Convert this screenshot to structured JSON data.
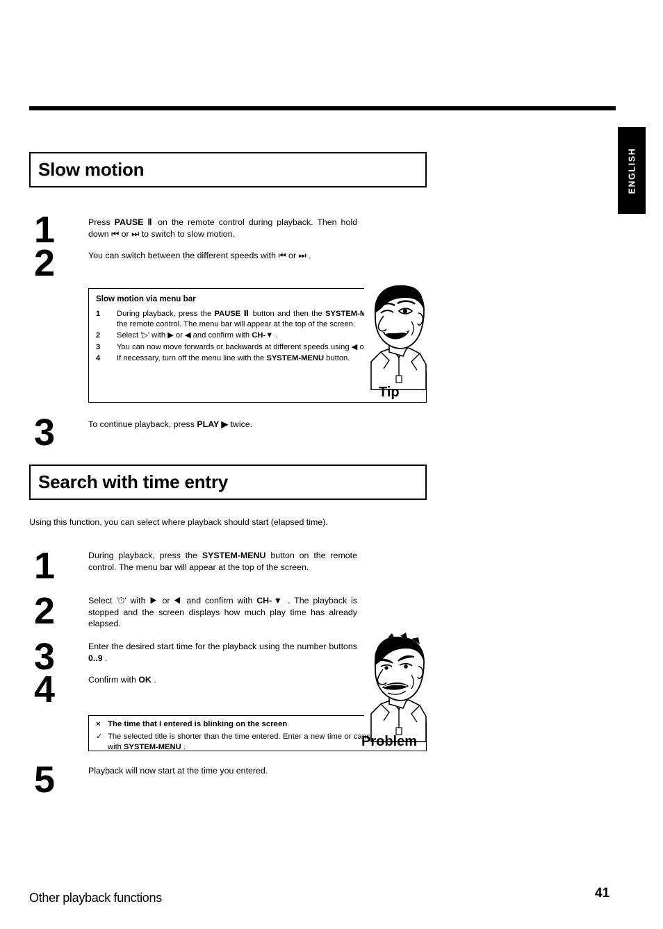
{
  "language_tab": "ENGLISH",
  "sections": [
    {
      "id": "slow-motion",
      "heading": "Slow motion",
      "steps": [
        {
          "number": "1",
          "text_html": "Press <b>PAUSE Ⅱ</b> on the remote control during playback. Then hold down ⏮ or ⏭ to switch to slow motion."
        },
        {
          "number": "2",
          "text_html": "You can switch between the different speeds with ⏮ or ⏭ ."
        },
        {
          "number": "3",
          "text_html": "To continue playback, press <b>PLAY ▶</b> twice."
        }
      ],
      "callout": {
        "kind": "tip",
        "label": "Tip",
        "title": "Slow motion via menu bar",
        "items": [
          {
            "number": "1",
            "text_html": "During playback, press the <b>PAUSE Ⅱ</b> button and then the <b>SYSTEM-MENU</b> button on the remote control. The menu bar will appear at the top of the screen."
          },
          {
            "number": "2",
            "text_html": "Select '▷' with ▶ or ◀ and confirm with <b>CH-▼</b> ."
          },
          {
            "number": "3",
            "text_html": "You can now move forwards or backwards at different speeds using ◀ or ▶ ."
          },
          {
            "number": "4",
            "text_html": "If necessary, turn off the menu line with the <b>SYSTEM-MENU</b> button."
          }
        ]
      }
    },
    {
      "id": "search-time-entry",
      "heading": "Search with time entry",
      "intro": "Using this function, you can select where playback should start (elapsed time).",
      "steps": [
        {
          "number": "1",
          "text_html": "During playback, press the <b>SYSTEM-MENU</b> button on the remote control. The menu bar will appear at the top of the screen."
        },
        {
          "number": "2",
          "text_html": "Select '⏱' with ▶ or ◀ and confirm with <b>CH-▼</b> . The playback is stopped and the screen displays how much play time has already elapsed."
        },
        {
          "number": "3",
          "text_html": "Enter the desired start time for the playback using the number buttons <b>0..9</b> ."
        },
        {
          "number": "4",
          "text_html": "Confirm with <b>OK</b> ."
        },
        {
          "number": "5",
          "text_html": "Playback will now start at the time you entered."
        }
      ],
      "callout": {
        "kind": "problem",
        "label": "Problem",
        "problem_mark": "×",
        "solution_mark": "✓",
        "problem_text": "The time that I entered is blinking on the screen",
        "solution_html": "The selected title is shorter than the time entered. Enter a new time or cancel the function with <b>SYSTEM-MENU</b> ."
      }
    }
  ],
  "footer": {
    "title": "Other playback functions",
    "page_number": "41"
  },
  "colors": {
    "ink": "#000000",
    "paper": "#ffffff"
  }
}
